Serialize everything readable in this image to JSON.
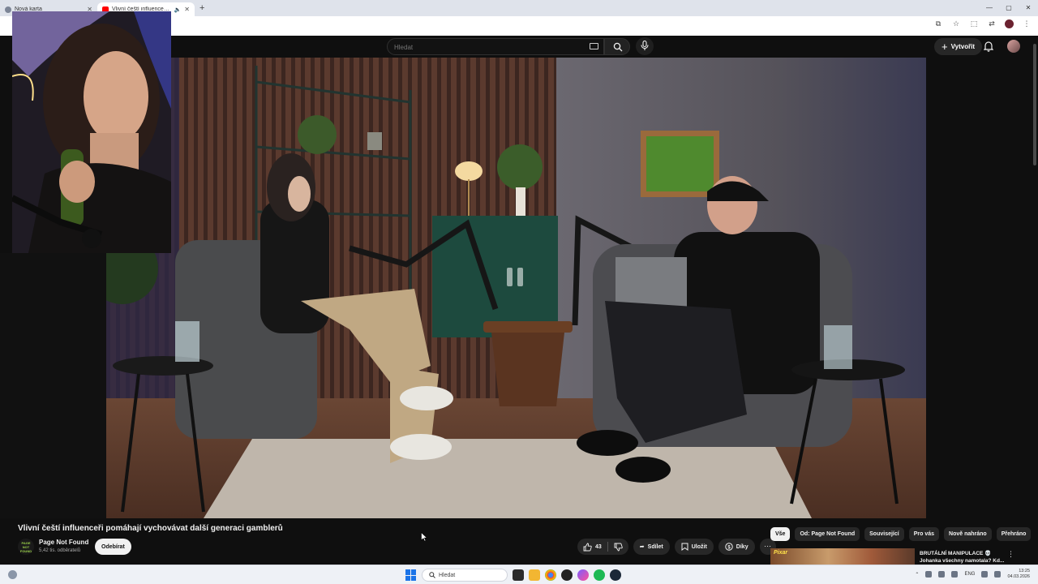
{
  "browser": {
    "tabs": [
      {
        "title": "Nová karta",
        "active": false
      },
      {
        "title": "Vlivní čeští influenceři pom",
        "active": true
      }
    ],
    "new_tab_symbol": "+",
    "window_controls": [
      "—",
      "▢",
      "✕"
    ]
  },
  "youtube": {
    "search_placeholder": "Hledat",
    "create_label": "Vytvořit",
    "icons": [
      "keyboard-icon",
      "search-icon",
      "mic-icon",
      "bell-icon",
      "avatar"
    ]
  },
  "video": {
    "title": "Vlivní čeští influenceři pomáhají vychovávat další generaci gamblerů",
    "channel_logo_text": "PAGE NOT FOUND",
    "channel": "Page Not Found",
    "subscribers": "5,42 tis. odběratelů",
    "subscribe_label": "Odebírat",
    "likes": "43",
    "share_label": "Sdílet",
    "save_label": "Uložit",
    "thanks_label": "Díky",
    "more_label": "···"
  },
  "chips": [
    {
      "label": "Vše",
      "selected": true
    },
    {
      "label": "Od: Page Not Found",
      "selected": false
    },
    {
      "label": "Související",
      "selected": false
    },
    {
      "label": "Pro vás",
      "selected": false
    },
    {
      "label": "Nově nahráno",
      "selected": false
    },
    {
      "label": "Přehráno",
      "selected": false
    }
  ],
  "recommendation": {
    "thumb_text": "Pixar",
    "title": "BRUTÁLNÍ MANIPULACE 💀 Johanka všechny namotala? Kd..."
  },
  "taskbar": {
    "search_placeholder": "Hledat",
    "language": "ENG",
    "time": "13:25",
    "date": "04.03.2026"
  },
  "colors": {
    "yt_bg": "#0f0f0f",
    "chip_selected": "#f1f1f1",
    "accent_red": "#ff0000"
  }
}
